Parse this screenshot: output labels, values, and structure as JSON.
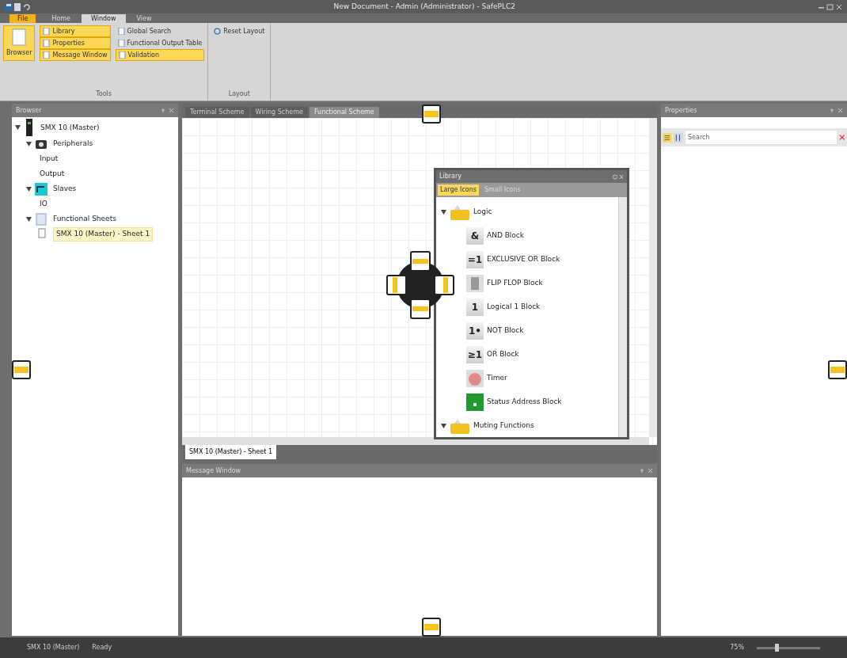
{
  "window": {
    "title": "New Document - Admin (Administrator) - SafePLC2"
  },
  "ribbon": {
    "app_button": "File",
    "tabs": [
      {
        "label": "Home",
        "selected": false
      },
      {
        "label": "Window",
        "selected": true
      },
      {
        "label": "View",
        "selected": false
      }
    ],
    "groups": [
      {
        "label": "Tools",
        "large": {
          "label": "Browser",
          "on": true
        },
        "columns": [
          [
            {
              "label": "Library",
              "on": true
            },
            {
              "label": "Properties",
              "on": true
            },
            {
              "label": "Message Window",
              "on": true
            }
          ],
          [
            {
              "label": "Global Search",
              "on": false
            },
            {
              "label": "Functional Output Table",
              "on": false
            },
            {
              "label": "Validation",
              "on": true
            }
          ]
        ]
      },
      {
        "label": "Layout",
        "columns": [
          [
            {
              "label": "Reset Layout",
              "on": false
            }
          ]
        ]
      }
    ]
  },
  "browser": {
    "title": "Browser",
    "tree": [
      {
        "label": "SMX 10 (Master)",
        "kind": "device",
        "expanded": true,
        "selected": false,
        "children": [
          {
            "label": "Peripherals",
            "kind": "camera",
            "expanded": true,
            "selected": false,
            "children": [
              {
                "label": "Input",
                "selected": false
              },
              {
                "label": "Output",
                "selected": false
              }
            ]
          },
          {
            "label": "Slaves",
            "kind": "slave",
            "expanded": true,
            "selected": false,
            "children": [
              {
                "label": "IO",
                "selected": false
              }
            ]
          },
          {
            "label": "Functional Sheets",
            "kind": "sheets",
            "expanded": true,
            "selected": false,
            "children": [
              {
                "label": "SMX 10 (Master) - Sheet 1",
                "kind": "sheet",
                "selected": true
              }
            ]
          }
        ]
      }
    ]
  },
  "document_tabs": [
    {
      "label": "Terminal Scheme",
      "selected": false
    },
    {
      "label": "Wiring Scheme",
      "selected": false
    },
    {
      "label": "Functional Scheme",
      "selected": true
    }
  ],
  "sheet_tabs": [
    {
      "label": "SMX 10 (Master) - Sheet 1",
      "selected": true
    }
  ],
  "library": {
    "title": "Library",
    "views": [
      {
        "label": "Large Icons",
        "selected": true
      },
      {
        "label": "Small Icons",
        "selected": false
      }
    ],
    "tree": [
      {
        "label": "Logic",
        "expanded": true,
        "children": [
          {
            "label": "AND Block",
            "kind": "glyph",
            "glyph": "&"
          },
          {
            "label": "EXCLUSIVE OR Block",
            "kind": "glyph",
            "glyph": "=1"
          },
          {
            "label": "FLIP FLOP Block",
            "kind": "flipflop"
          },
          {
            "label": "Logical 1 Block",
            "kind": "glyph",
            "glyph": "1"
          },
          {
            "label": "NOT Block",
            "kind": "glyph",
            "glyph": "1•"
          },
          {
            "label": "OR Block",
            "kind": "glyph",
            "glyph": "≥1"
          },
          {
            "label": "Timer",
            "kind": "timer"
          },
          {
            "label": "Status Address Block",
            "kind": "status"
          }
        ]
      },
      {
        "label": "Muting Functions",
        "expanded": true
      }
    ]
  },
  "message_window": {
    "title": "Message Window"
  },
  "properties": {
    "title": "Properties",
    "search": {
      "placeholder": "Search"
    }
  },
  "status_bar": {
    "left": [
      "SMX 10 (Master)",
      "Ready"
    ],
    "zoom": "75%",
    "level": 0.3
  }
}
